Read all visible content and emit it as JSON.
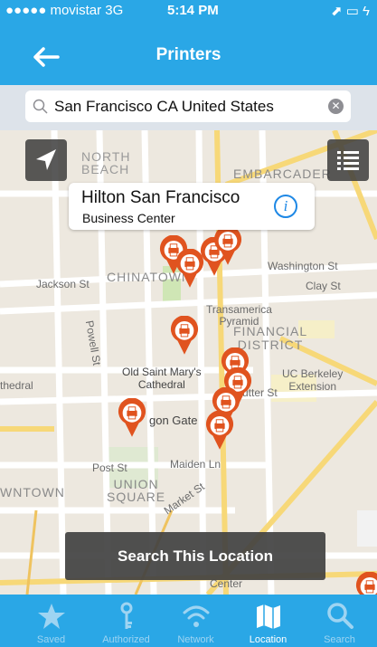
{
  "status": {
    "carrier": "●●●●● movistar 3G",
    "time": "5:14 PM",
    "right": "⬈ ▭ ϟ"
  },
  "nav": {
    "title": "Printers"
  },
  "search": {
    "value": "San Francisco CA United States"
  },
  "callout": {
    "title": "Hilton San Francisco",
    "subtitle": "Business Center"
  },
  "map_labels": {
    "north_beach": "NORTH\nBEACH",
    "embarcadero": "EMBARCADER",
    "chinatown": "CHINATOWN",
    "jackson": "Jackson St",
    "washington": "Washington St",
    "clay": "Clay St",
    "transamerica": "Transamerica\nPyramid",
    "financial": "FINANCIAL\nDISTRICT",
    "old_saint_marys": "Old Saint Mary's\nCathedral",
    "uc_berkeley": "UC Berkeley\nExtension",
    "cathedral": "thedral",
    "gate": "gon Gate",
    "sutter": "utter St",
    "post": "Post St",
    "maiden": "Maiden Ln",
    "union_square": "UNION\nSQUARE",
    "downtown": "WNTOWN",
    "market": "Market St",
    "powell": "Powell St",
    "center": "Center"
  },
  "search_location": {
    "label": "Search This Location"
  },
  "tabs": [
    {
      "label": "Saved"
    },
    {
      "label": "Authorized"
    },
    {
      "label": "Network"
    },
    {
      "label": "Location"
    },
    {
      "label": "Search"
    }
  ],
  "colors": {
    "accent": "#2aa7e6",
    "pin": "#e0531f"
  }
}
